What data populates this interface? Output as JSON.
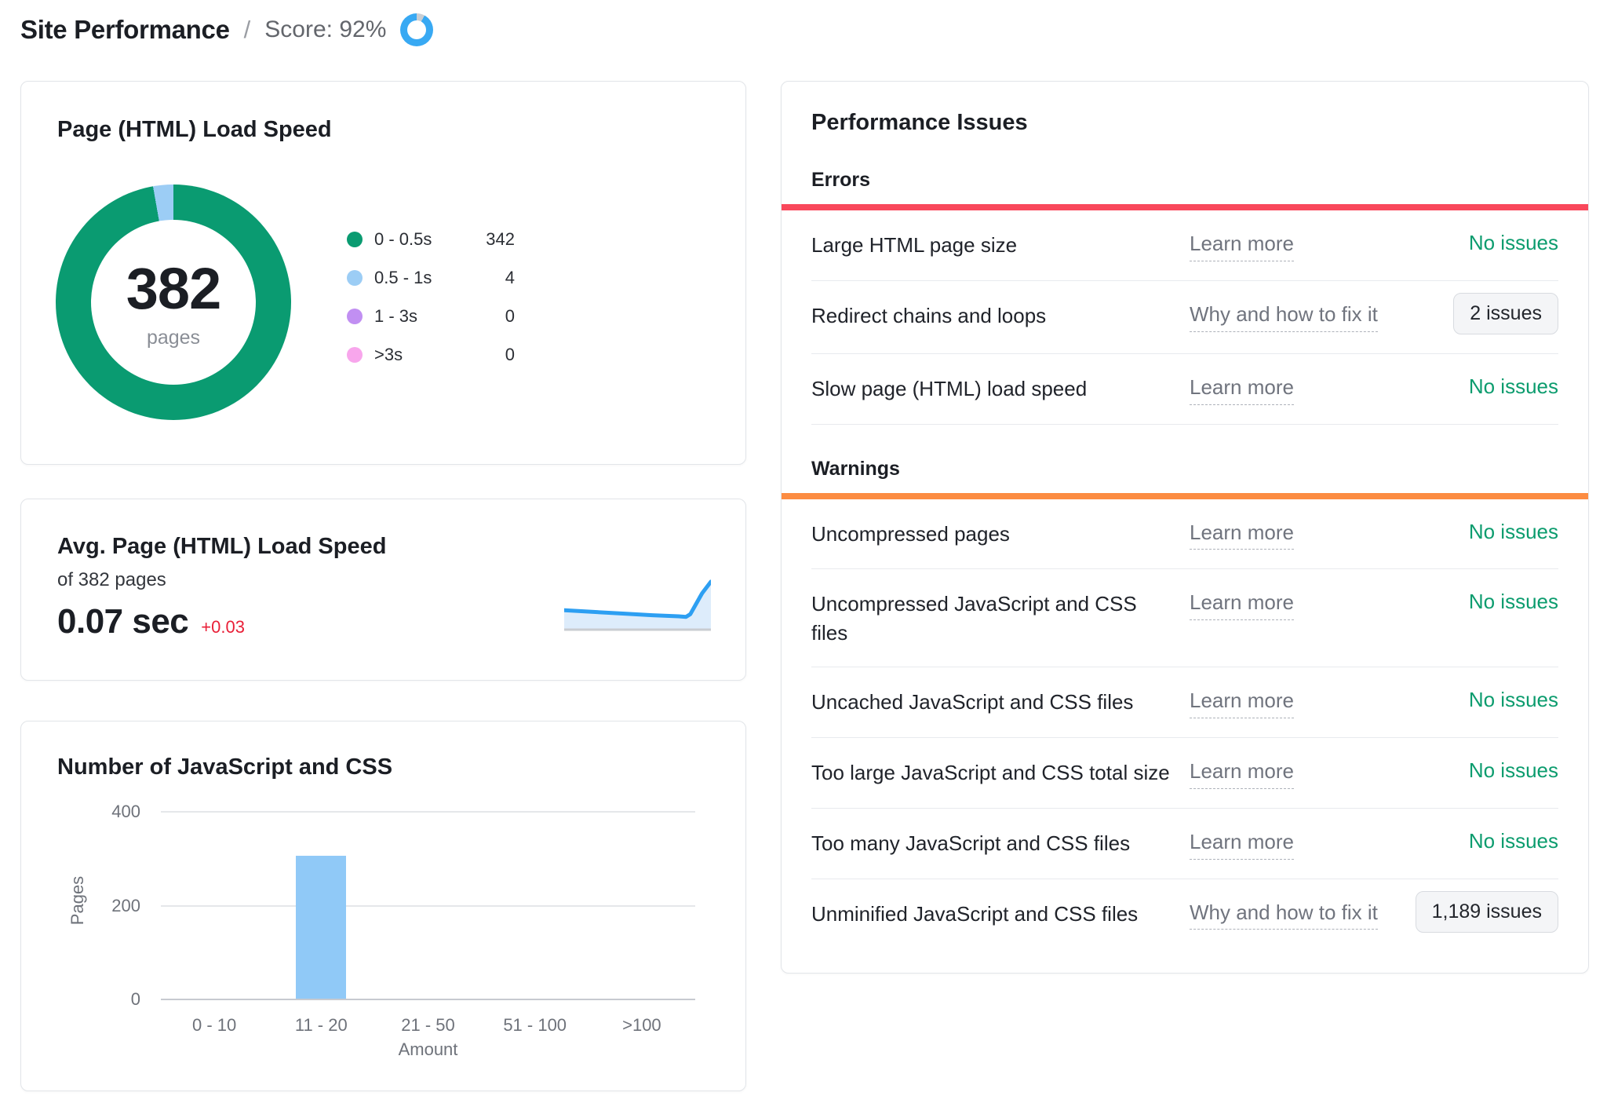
{
  "header": {
    "title": "Site Performance",
    "divider": "/",
    "score_label": "Score: 92%",
    "score_percent": 92,
    "colors": {
      "ring_accent": "#38a9f3",
      "ring_rest": "#c9cdd2"
    }
  },
  "cards": {
    "load_speed": {
      "title": "Page (HTML) Load Speed"
    },
    "avg_speed": {
      "title": "Avg. Page (HTML) Load Speed",
      "subtitle": "of 382 pages",
      "value": "0.07 sec",
      "delta": "+0.03"
    },
    "js_css": {
      "title": "Number of JavaScript and CSS"
    }
  },
  "chart_data": [
    {
      "type": "pie",
      "title": "Page (HTML) Load Speed",
      "center_label": "382",
      "center_sublabel": "pages",
      "legend_position": "right",
      "slices": [
        {
          "label": "0 - 0.5s",
          "value": 342,
          "color": "#0a9b71"
        },
        {
          "label": "0.5 - 1s",
          "value": 4,
          "color": "#9ccdf5"
        },
        {
          "label": "1 - 3s",
          "value": 0,
          "color": "#c18ff2"
        },
        {
          "label": ">3s",
          "value": 0,
          "color": "#f8a6ec"
        }
      ]
    },
    {
      "type": "area",
      "title": "Avg. Page (HTML) Load Speed trend",
      "current_value_sec": 0.07,
      "delta_sec": 0.03,
      "line_color": "#2d9ff2",
      "fill_color": "#ddecfb",
      "baseline_color": "#c9ccd1",
      "points_norm": [
        [
          0,
          0.59
        ],
        [
          0.2,
          0.62
        ],
        [
          0.4,
          0.65
        ],
        [
          0.6,
          0.68
        ],
        [
          0.78,
          0.7
        ],
        [
          0.83,
          0.71
        ],
        [
          0.86,
          0.66
        ],
        [
          0.9,
          0.47
        ],
        [
          0.94,
          0.28
        ],
        [
          1,
          0.07
        ]
      ]
    },
    {
      "type": "bar",
      "title": "Number of JavaScript and CSS",
      "categories": [
        "0 - 10",
        "11 - 20",
        "21 - 50",
        "51 - 100",
        ">100"
      ],
      "values": [
        0,
        305,
        0,
        0,
        0
      ],
      "xlabel": "Amount",
      "ylabel": "Pages",
      "yticks": [
        0,
        200,
        400
      ],
      "ylim": [
        0,
        400
      ],
      "bar_color": "#90c9f7",
      "grid": true,
      "legend_position": "none"
    }
  ],
  "issues": {
    "title": "Performance Issues",
    "ok_color": "#0c9c6e",
    "sections": [
      {
        "heading": "Errors",
        "accent_color": "#f9485b",
        "rows": [
          {
            "name": "Large HTML page size",
            "link": "Learn more",
            "status": "No issues",
            "status_type": "text"
          },
          {
            "name": "Redirect chains and loops",
            "link": "Why and how to fix it",
            "status": "2 issues",
            "status_type": "button"
          },
          {
            "name": "Slow page (HTML) load speed",
            "link": "Learn more",
            "status": "No issues",
            "status_type": "text"
          }
        ]
      },
      {
        "heading": "Warnings",
        "accent_color": "#fc8c42",
        "rows": [
          {
            "name": "Uncompressed pages",
            "link": "Learn more",
            "status": "No issues",
            "status_type": "text"
          },
          {
            "name": "Uncompressed JavaScript and CSS files",
            "link": "Learn more",
            "status": "No issues",
            "status_type": "text"
          },
          {
            "name": "Uncached JavaScript and CSS files",
            "link": "Learn more",
            "status": "No issues",
            "status_type": "text"
          },
          {
            "name": "Too large JavaScript and CSS total size",
            "link": "Learn more",
            "status": "No issues",
            "status_type": "text"
          },
          {
            "name": "Too many JavaScript and CSS files",
            "link": "Learn more",
            "status": "No issues",
            "status_type": "text"
          },
          {
            "name": "Unminified JavaScript and CSS files",
            "link": "Why and how to fix it",
            "status": "1,189 issues",
            "status_type": "button"
          }
        ]
      }
    ]
  }
}
